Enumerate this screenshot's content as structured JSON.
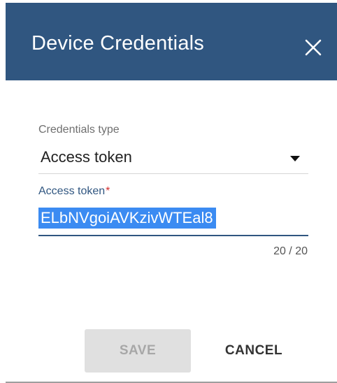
{
  "dialog": {
    "title": "Device Credentials",
    "close_icon": "close-icon"
  },
  "credentials_type": {
    "label": "Credentials type",
    "selected": "Access token",
    "dropdown_icon": "dropdown-arrow-icon"
  },
  "access_token": {
    "label": "Access token",
    "required_marker": "*",
    "value": "ELbNVgoiAVKzivWTEal8",
    "counter": "20 / 20",
    "selected": true
  },
  "actions": {
    "save_label": "SAVE",
    "save_enabled": false,
    "cancel_label": "CANCEL"
  },
  "colors": {
    "header_bg": "#305680",
    "accent": "#305680",
    "selection": "#3b8bf2",
    "required": "#d32f2f",
    "disabled_button_bg": "#e0e0e0"
  }
}
